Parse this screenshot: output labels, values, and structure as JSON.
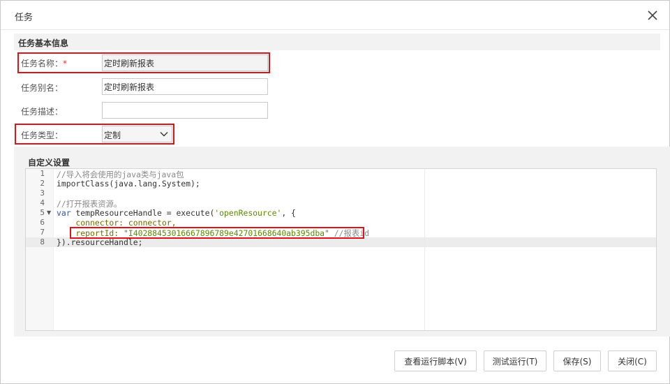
{
  "dialog": {
    "title": "任务",
    "close_icon": "close-icon"
  },
  "basic_section": {
    "heading": "任务基本信息",
    "name_label": "任务名称：",
    "name_required": "*",
    "name_value": "定时刷新报表",
    "alias_label": "任务别名：",
    "alias_value": "定时刷新报表",
    "desc_label": "任务描述：",
    "desc_value": "",
    "type_label": "任务类型：",
    "type_value": "定制"
  },
  "custom_section": {
    "heading": "自定义设置",
    "line_numbers": [
      "1",
      "2",
      "3",
      "4",
      "5",
      "6",
      "7",
      "8"
    ],
    "code": {
      "l1": "//导入将会使用的java类与java包",
      "l2": "importClass(java.lang.System);",
      "l4": "//打开报表资源。",
      "l5_kw": "var",
      "l5_a": " tempResourceHandle = execute(",
      "l5_str": "'openResource'",
      "l5_b": ", {",
      "l6": "    connector: connector,",
      "l7_prop": "    reportId: ",
      "l7_str": "\"I40288453016667896789e42701668640ab395dba\"",
      "l7_com": " //报表id",
      "l8": "}).resourceHandle;"
    }
  },
  "footer": {
    "view_script": "查看运行脚本(V)",
    "test_run": "测试运行(T)",
    "save": "保存(S)",
    "close": "关闭(C)"
  },
  "colors": {
    "highlight_box": "#d9141b",
    "required_star": "#e0321e",
    "code_keyword": "#2a56c6",
    "code_string": "#5a8a00",
    "code_comment": "#8a8a8a"
  }
}
